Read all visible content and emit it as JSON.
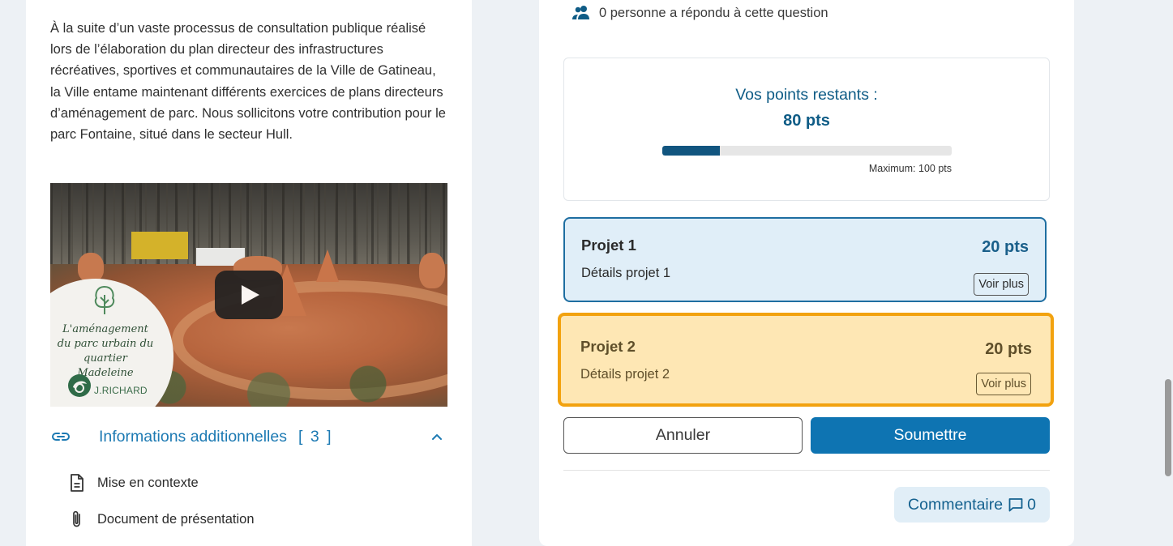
{
  "left": {
    "intro": " À la suite d’un vaste processus de consultation publique réalisé lors de l’élaboration du plan directeur des infrastructures récréatives, sportives et communautaires de la Ville de Gatineau, la Ville entame maintenant différents exercices de plans directeurs d’aménagement de parc. Nous sollicitons votre contribution pour le parc Fontaine, situé dans le secteur Hull.",
    "video": {
      "overlay_title": "L'aménagement du parc urbain du quartier Madeleine",
      "brand": "J.RICHARD",
      "play_icon": "play-icon"
    },
    "additional_info": {
      "label": "Informations additionnelles",
      "count": "[ 3 ]",
      "icon": "link-icon",
      "toggle_icon": "chevron-up-icon",
      "items": [
        {
          "label": "Mise en contexte",
          "icon": "document-icon"
        },
        {
          "label": "Document de présentation",
          "icon": "paperclip-icon"
        }
      ]
    }
  },
  "right": {
    "responded": {
      "text": "0 personne a répondu à cette question",
      "icon": "people-icon"
    },
    "points": {
      "label": "Vos points restants :",
      "value": "80 pts",
      "max_label": "Maximum: 100 pts",
      "used_fraction": 0.2,
      "bar_color": "#11557f"
    },
    "projects": [
      {
        "name": "Projet 1",
        "points": "20 pts",
        "details": "Détails projet 1",
        "more": "Voir plus",
        "accent": "#1e6ea1",
        "background": "#e0eef8"
      },
      {
        "name": "Projet 2",
        "points": "20 pts",
        "details": "Détails projet 2",
        "more": "Voir plus",
        "accent": "#f2a20f",
        "background": "#fee7b4"
      }
    ],
    "actions": {
      "cancel": "Annuler",
      "submit": "Soumettre"
    },
    "comment": {
      "label": "Commentaire",
      "count": "0",
      "icon": "comment-icon"
    }
  },
  "colors": {
    "primary": "#0e74b2",
    "link": "#1d7ab3",
    "page_bg": "#edf1f5"
  }
}
